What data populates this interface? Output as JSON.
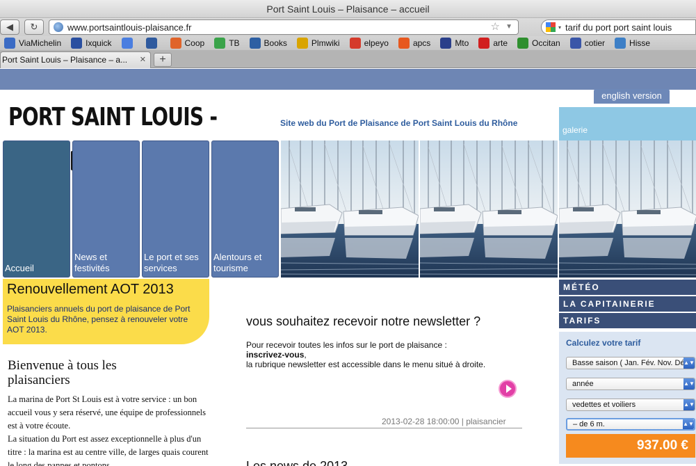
{
  "browser": {
    "window_title": "Port Saint Louis – Plaisance – accueil",
    "url": "www.portsaintlouis-plaisance.fr",
    "search_query": "tarif du port port saint louis",
    "bookmarks": [
      "ViaMichelin",
      "Ixquick",
      "",
      "",
      "Coop",
      "TB",
      "Books",
      "Plmwiki",
      "elpeyo",
      "apcs",
      "Mto",
      "arte",
      "Occitan",
      "cotier",
      "Hisse"
    ],
    "tab_title": "Port Saint Louis – Plaisance – a...",
    "new_tab": "+"
  },
  "site": {
    "english_link": "english version",
    "title": "PORT SAINT LOUIS -",
    "subtitle": "Site web du Port de Plaisance de Port Saint Louis du Rhône",
    "galerie": "galerie"
  },
  "nav": [
    {
      "label": "Accueil",
      "active": true
    },
    {
      "label": "News et festivités",
      "active": false
    },
    {
      "label": "Le port et ses services",
      "active": false
    },
    {
      "label": "Alentours et tourisme",
      "active": false
    }
  ],
  "right_menu": {
    "meteo": "MÉTÉO",
    "capitainerie": "LA CAPITAINERIE",
    "tarifs": "TARIFS"
  },
  "calculator": {
    "title": "Calculez votre tarif",
    "season": "Basse saison ( Jan. Fév. Nov. Déc.)",
    "period": "année",
    "boat_type": "vedettes et voiliers",
    "length": "– de 6 m.",
    "price": "937.00 €"
  },
  "aot": {
    "title": "Renouvellement AOT 2013",
    "text": "Plaisanciers annuels du port de plaisance de Port Saint Louis du Rhône, pensez à renouveler votre AOT 2013."
  },
  "welcome": {
    "title": "Bienvenue à tous les plaisanciers",
    "p1": "La marina de Port St Louis est à votre service : un bon accueil vous y sera réservé, une équipe de professionnels est à votre écoute.",
    "p2": "La situation du Port est assez exceptionnelle à plus d'un titre : la marina est au centre ville, de larges quais courent le long des pannes et pontons"
  },
  "newsletter": {
    "title": "vous souhaitez recevoir notre newsletter ?",
    "line1": "Pour recevoir toutes les infos sur le port de plaisance :",
    "line2": "inscrivez-vous",
    "line2_suffix": ",",
    "line3": "la rubrique newsletter est accessible dans le menu situé à droite.",
    "meta": "2013-02-28 18:00:00 | plaisancier",
    "next_title": "Les news de 2013"
  },
  "colors": {
    "page_blue": "#6e86b4",
    "nav_tile": "#5b79ad",
    "nav_active": "#3a6585",
    "menu_dark": "#3a4f78",
    "aot_yellow": "#fbdc4a",
    "price_orange": "#f68a1e",
    "accent_pink": "#e23fa6"
  }
}
